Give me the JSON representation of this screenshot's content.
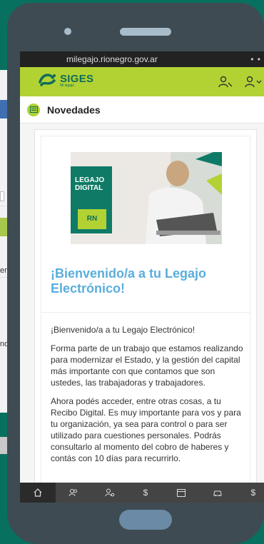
{
  "browser": {
    "url": "milegajo.rionegro.gov.ar"
  },
  "header": {
    "brand": "SIGES",
    "brand_sub": "Mi legajo"
  },
  "section": {
    "title": "Novedades"
  },
  "hero": {
    "badge_line1": "LEGAJO",
    "badge_line2": "DIGITAL",
    "badge_logo": "RN"
  },
  "article": {
    "title": "¡Bienvenido/a a tu Legajo Electrónico!",
    "paragraphs": [
      "¡Bienvenido/a a tu Legajo Electrónico!",
      "Forma parte de un trabajo que estamos realizando para modernizar el Estado, y la gestión del capital más importante con que contamos que son ustedes, las trabajadoras y trabajadores.",
      "Ahora podés acceder, entre otras cosas, a tu Recibo Digital. Es muy importante para vos y para tu organización, ya sea para control o para ser utilizado para cuestiones personales. Podrás consultarlo al momento del cobro de haberes y contás con 10 días para recurrirlo."
    ]
  },
  "background_page": {
    "text_1": "ere",
    "text_2": "no"
  },
  "nav": {
    "items": [
      {
        "icon": "home-icon"
      },
      {
        "icon": "people-icon"
      },
      {
        "icon": "user-settings-icon"
      },
      {
        "icon": "dollar-icon",
        "label": "$"
      },
      {
        "icon": "calendar-icon"
      },
      {
        "icon": "car-icon"
      },
      {
        "icon": "dollar-icon",
        "label": "$"
      }
    ]
  },
  "colors": {
    "primary_green": "#b2d234",
    "dark_green": "#0f6d58",
    "title_blue": "#5aaedc",
    "background_teal": "#08705f"
  }
}
